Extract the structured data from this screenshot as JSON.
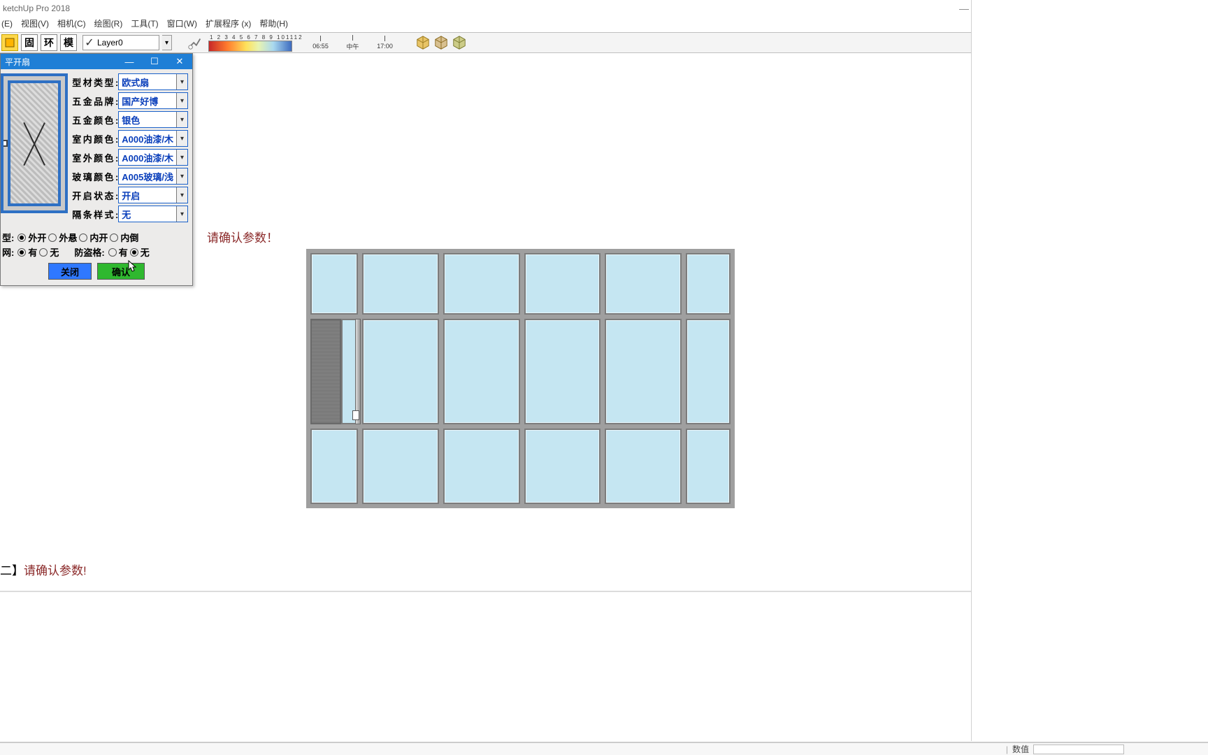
{
  "app": {
    "title": "ketchUp Pro 2018"
  },
  "menu": [
    "(E)",
    "视图(V)",
    "相机(C)",
    "绘图(R)",
    "工具(T)",
    "窗口(W)",
    "扩展程序 (x)",
    "帮助(H)"
  ],
  "toolbar": {
    "layer_label": "Layer0",
    "numbers": "1 2 3 4 5 6 7 8 9 101112",
    "t1": "06:55",
    "t2": "中午",
    "t3": "17:00"
  },
  "dialog": {
    "title": "平开扇",
    "fields": [
      {
        "label": "型材类型:",
        "value": "欧式扇"
      },
      {
        "label": "五金品牌:",
        "value": "国产好博"
      },
      {
        "label": "五金颜色:",
        "value": "银色"
      },
      {
        "label": "室内颜色:",
        "value": "A000油漆/木"
      },
      {
        "label": "室外颜色:",
        "value": "A000油漆/木"
      },
      {
        "label": "玻璃颜色:",
        "value": "A005玻璃/浅"
      },
      {
        "label": "开启状态:",
        "value": "开启"
      },
      {
        "label": "隔条样式:",
        "value": "无"
      }
    ],
    "row1": {
      "label": "型:",
      "opts": [
        "外开",
        "外悬",
        "内开",
        "内倒"
      ],
      "sel": 0
    },
    "row2a": {
      "label": "网:",
      "opts": [
        "有",
        "无"
      ],
      "sel": 0
    },
    "row2b": {
      "label": "防盗格:",
      "opts": [
        "有",
        "无"
      ],
      "sel": 1
    },
    "btn_close": "关闭",
    "btn_ok": "确认"
  },
  "hints": {
    "h1": "请确认参数！",
    "h2_prefix": "二】",
    "h2_body": "请确认参数!"
  },
  "status": {
    "label": "数值"
  }
}
